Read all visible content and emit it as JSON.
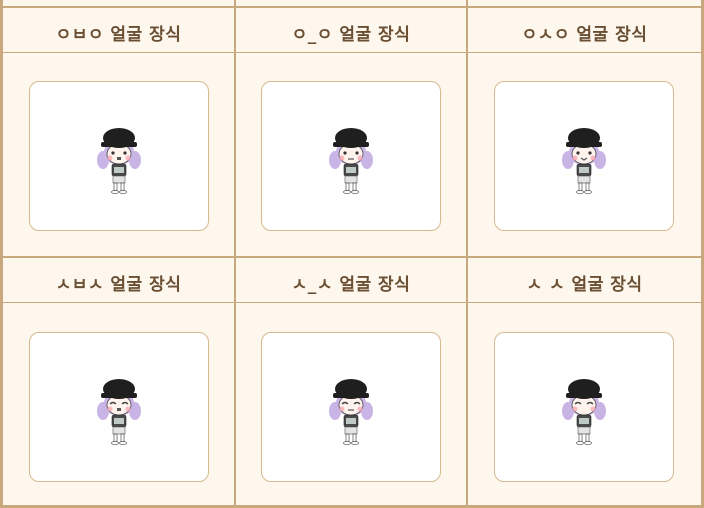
{
  "colors": {
    "background": "#fdf7ee",
    "border": "#c8a87c",
    "card_border": "#d7b98e",
    "header_text": "#6b4f33",
    "hat": "#1f1f1f",
    "hair": "#c9b4e6",
    "skin": "#fff3ee",
    "blush": "#f7a7b3"
  },
  "items": [
    {
      "label": "ㅇㅂㅇ 얼굴 장식",
      "face": "open-mouth"
    },
    {
      "label": "ㅇ_ㅇ 얼굴 장식",
      "face": "neutral"
    },
    {
      "label": "ㅇㅅㅇ 얼굴 장식",
      "face": "cat-mouth"
    },
    {
      "label": "ㅅㅂㅅ 얼굴 장식",
      "face": "closed-open"
    },
    {
      "label": "ㅅ_ㅅ 얼굴 장식",
      "face": "closed-flat"
    },
    {
      "label": "ㅅ ㅅ 얼굴 장식",
      "face": "closed-smile"
    }
  ]
}
